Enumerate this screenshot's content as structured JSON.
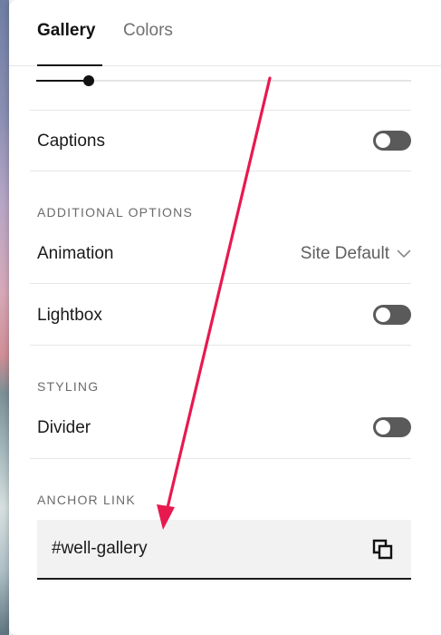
{
  "tabs": [
    {
      "label": "Gallery",
      "active": true
    },
    {
      "label": "Colors",
      "active": false
    }
  ],
  "slider": {
    "value_fraction": 0.14
  },
  "captions": {
    "label": "Captions",
    "enabled": false
  },
  "additional_options": {
    "title": "ADDITIONAL OPTIONS",
    "animation": {
      "label": "Animation",
      "value": "Site Default"
    },
    "lightbox": {
      "label": "Lightbox",
      "enabled": false
    }
  },
  "styling": {
    "title": "STYLING",
    "divider": {
      "label": "Divider",
      "enabled": false
    }
  },
  "anchor_link": {
    "title": "ANCHOR LINK",
    "value": "#well-gallery"
  },
  "icons": {
    "chevron": "chevron-down-icon",
    "copy": "copy-icon",
    "annotation_arrow": "arrow-icon"
  },
  "colors": {
    "annotation_arrow": "#e8194f",
    "toggle_off": "#5a5a5a",
    "field_background": "#f2f2f2"
  }
}
